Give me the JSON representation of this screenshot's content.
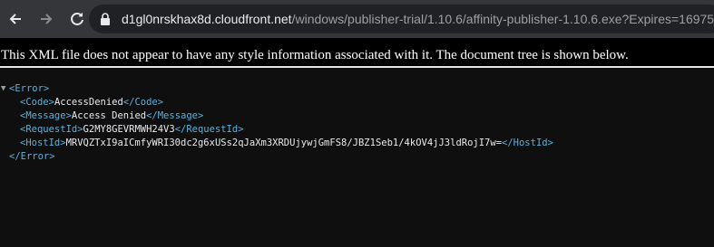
{
  "browser": {
    "url_host": "d1gl0nrskhax8d.cloudfront.net",
    "url_path": "/windows/publisher-trial/1.10.6/affinity-publisher-1.10.6.exe?Expires=16975"
  },
  "banner": {
    "text": "This XML file does not appear to have any style information associated with it. The document tree is shown below."
  },
  "xml": {
    "root_open": "<Error>",
    "root_close": "</Error>",
    "code": {
      "open": "<Code>",
      "value": "AccessDenied",
      "close": "</Code>"
    },
    "message": {
      "open": "<Message>",
      "value": "Access Denied",
      "close": "</Message>"
    },
    "request_id": {
      "open": "<RequestId>",
      "value": "G2MY8GEVRMWH24V3",
      "close": "</RequestId>"
    },
    "host_id": {
      "open": "<HostId>",
      "value": "MRVQZTxI9aICmfyWRI30dc2g6xUSs2qJaXm3XRDUjywjGmFS8/JBZ1Seb1/4kOV4jJ3ldRojI7w=",
      "close": "</HostId>"
    }
  }
}
